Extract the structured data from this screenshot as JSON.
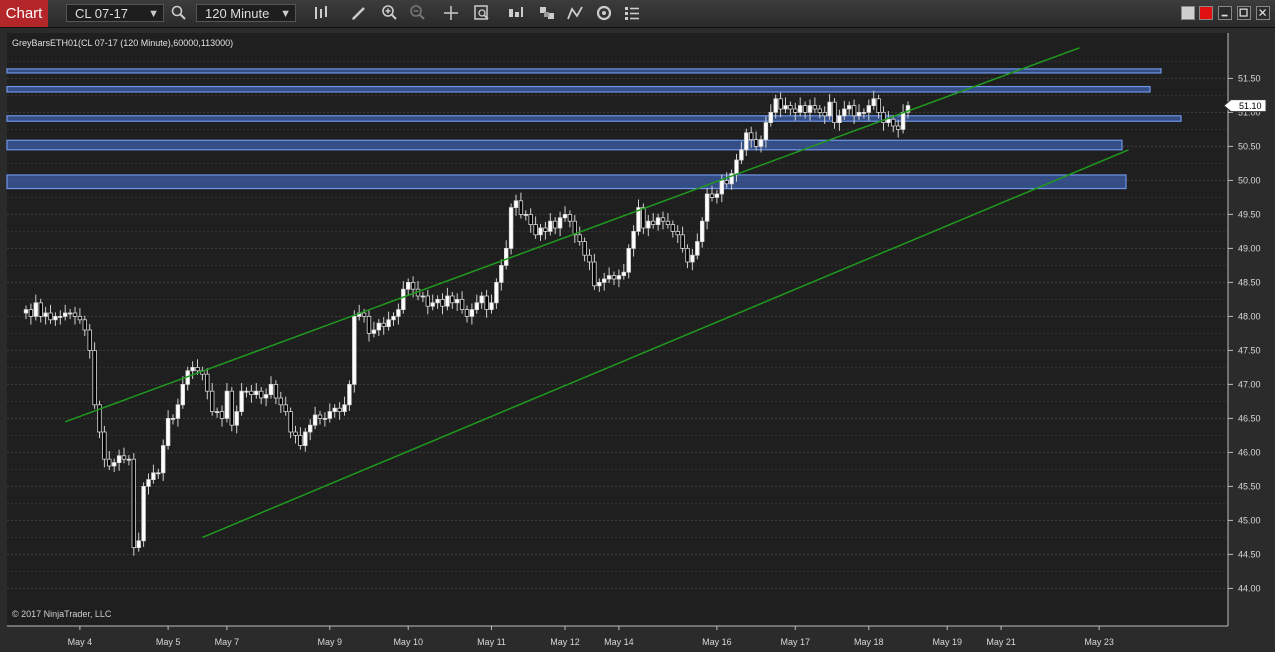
{
  "toolbar": {
    "chart_tab": "Chart",
    "instrument": "CL 07-17",
    "interval": "120 Minute"
  },
  "indicator_label": "GreyBarsETH01(CL 07-17 (120 Minute),60000,113000)",
  "copyright": "© 2017 NinjaTrader, LLC",
  "colors": {
    "background": "#1f1f1f",
    "grid": "#3f3f3f",
    "channel": "#1f9a1f",
    "zone_fill": "#3c5ea8",
    "zone_stroke": "#6f95e8",
    "up_candle": "#ffffff",
    "down_candle": "#000000",
    "tab": "#b3262a"
  },
  "chart_data": {
    "type": "candlestick",
    "ylim": [
      43.8,
      51.8
    ],
    "yticks": [
      "44.00",
      "44.50",
      "45.00",
      "45.50",
      "46.00",
      "46.50",
      "47.00",
      "47.50",
      "48.00",
      "48.50",
      "49.00",
      "49.50",
      "50.00",
      "50.50",
      "51.00",
      "51.50"
    ],
    "last_price": "51.10",
    "x_labels": [
      "May 4",
      "May 5",
      "May 7",
      "May 9",
      "May 10",
      "May 11",
      "May 12",
      "May 14",
      "May 16",
      "May 17",
      "May 18",
      "May 19",
      "May 21",
      "May 23"
    ],
    "x_label_bar_index": [
      11,
      29,
      41,
      62,
      78,
      95,
      110,
      121,
      141,
      157,
      172,
      188,
      199,
      219
    ],
    "closes": [
      48.1,
      48.0,
      48.2,
      48.0,
      48.05,
      47.95,
      48.0,
      48.0,
      48.05,
      48.05,
      48.0,
      47.95,
      47.8,
      47.5,
      46.7,
      46.3,
      45.9,
      45.8,
      45.85,
      45.95,
      45.9,
      45.9,
      44.6,
      44.7,
      45.5,
      45.6,
      45.7,
      45.7,
      46.1,
      46.5,
      46.5,
      46.7,
      47.0,
      47.2,
      47.25,
      47.2,
      47.15,
      46.9,
      46.6,
      46.6,
      46.5,
      46.9,
      46.4,
      46.6,
      46.9,
      46.9,
      46.85,
      46.9,
      46.8,
      46.85,
      47.0,
      46.8,
      46.7,
      46.6,
      46.3,
      46.25,
      46.1,
      46.3,
      46.4,
      46.55,
      46.5,
      46.5,
      46.6,
      46.65,
      46.6,
      46.7,
      47.0,
      48.0,
      48.05,
      48.0,
      47.75,
      47.8,
      47.9,
      47.85,
      47.95,
      48.0,
      48.1,
      48.4,
      48.5,
      48.4,
      48.3,
      48.3,
      48.15,
      48.2,
      48.25,
      48.15,
      48.3,
      48.2,
      48.25,
      48.1,
      48.0,
      48.1,
      48.2,
      48.3,
      48.1,
      48.2,
      48.5,
      48.75,
      49.0,
      49.6,
      49.7,
      49.5,
      49.5,
      49.35,
      49.2,
      49.3,
      49.25,
      49.4,
      49.3,
      49.45,
      49.5,
      49.4,
      49.2,
      49.1,
      48.9,
      48.8,
      48.45,
      48.5,
      48.55,
      48.6,
      48.55,
      48.6,
      48.65,
      49.0,
      49.25,
      49.6,
      49.3,
      49.4,
      49.35,
      49.45,
      49.4,
      49.35,
      49.25,
      49.2,
      49.0,
      48.8,
      48.9,
      49.1,
      49.4,
      49.8,
      49.75,
      49.8,
      50.0,
      49.95,
      50.1,
      50.3,
      50.45,
      50.7,
      50.6,
      50.5,
      50.6,
      50.85,
      51.0,
      51.2,
      51.05,
      51.1,
      51.05,
      51.0,
      51.1,
      51.0,
      51.1,
      51.05,
      51.0,
      50.95,
      51.15,
      50.85,
      50.95,
      51.05,
      51.1,
      50.95,
      51.0,
      51.0,
      51.1,
      51.2,
      51.0,
      50.85,
      50.9,
      50.8,
      50.75,
      51.0,
      51.1
    ],
    "levels": [
      {
        "low": 51.58,
        "high": 51.64
      },
      {
        "low": 51.3,
        "high": 51.38
      },
      {
        "low": 50.87,
        "high": 50.95
      },
      {
        "low": 50.45,
        "high": 50.59
      },
      {
        "low": 49.88,
        "high": 50.08
      }
    ],
    "channels": [
      {
        "from": [
          8,
          46.45
        ],
        "to": [
          215,
          51.95
        ]
      },
      {
        "from": [
          36,
          44.75
        ],
        "to": [
          225,
          50.45
        ]
      }
    ]
  }
}
